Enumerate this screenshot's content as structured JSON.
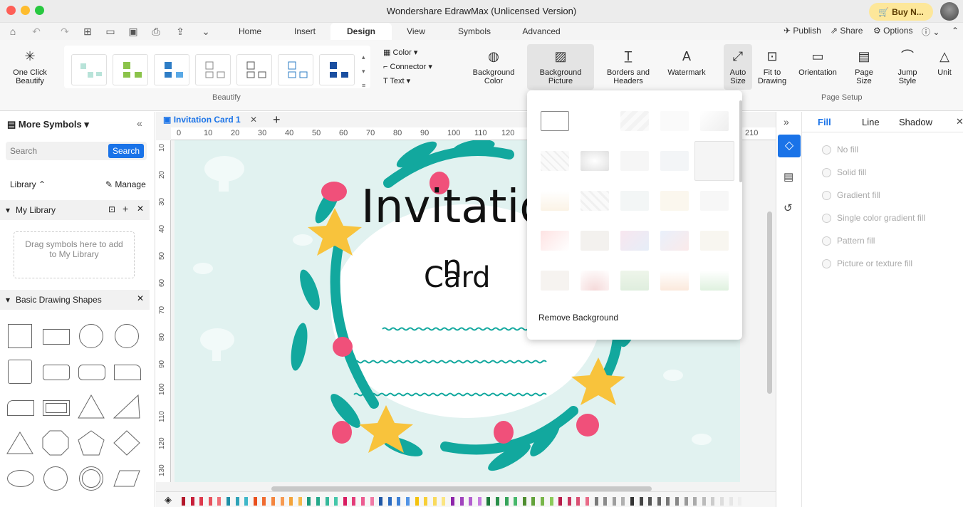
{
  "window": {
    "title": "Wondershare EdrawMax (Unlicensed Version)",
    "buy_label": "Buy N..."
  },
  "menu": {
    "tabs": [
      "Home",
      "Insert",
      "Design",
      "View",
      "Symbols",
      "Advanced"
    ],
    "active_tab": "Design",
    "publish": "Publish",
    "share": "Share",
    "options": "Options"
  },
  "ribbon": {
    "one_click_beautify": "One Click Beautify",
    "color": "Color",
    "connector": "Connector",
    "text": "Text",
    "beautify_label": "Beautify",
    "background_color": "Background Color",
    "background_picture": "Background Picture",
    "borders_headers": "Borders and Headers",
    "watermark": "Watermark",
    "auto_size": "Auto Size",
    "fit_to_drawing": "Fit to Drawing",
    "orientation": "Orientation",
    "page_size": "Page Size",
    "jump_style": "Jump Style",
    "unit": "Unit",
    "page_setup_label": "Page Setup"
  },
  "left_panel": {
    "title": "More Symbols",
    "search_placeholder": "Search",
    "search_button": "Search",
    "library": "Library",
    "manage": "Manage",
    "my_library": "My Library",
    "drag_hint": "Drag symbols here to add to My Library",
    "basic_shapes": "Basic Drawing Shapes"
  },
  "document": {
    "tab_name": "Invitation Card 1",
    "ruler_h": [
      "0",
      "10",
      "20",
      "30",
      "40",
      "50",
      "60",
      "70",
      "80",
      "90",
      "100",
      "110",
      "120",
      "210"
    ],
    "ruler_v": [
      "10",
      "20",
      "30",
      "40",
      "50",
      "60",
      "70",
      "80",
      "90",
      "100",
      "110",
      "120",
      "130"
    ],
    "title_line1": "Invitatio",
    "title_line2": "n",
    "title_line3": "Card"
  },
  "dropdown": {
    "remove_background": "Remove Background"
  },
  "right_panel": {
    "tabs": [
      "Fill",
      "Line",
      "Shadow"
    ],
    "active_tab": "Fill",
    "options": [
      "No fill",
      "Solid fill",
      "Gradient fill",
      "Single color gradient fill",
      "Pattern fill",
      "Picture or texture fill"
    ]
  },
  "colors": {
    "accent": "#1a73e8",
    "teal": "#12a89e",
    "pink": "#f0507a",
    "yellow": "#f8c33c",
    "page_bg": "#e1f2f0"
  }
}
